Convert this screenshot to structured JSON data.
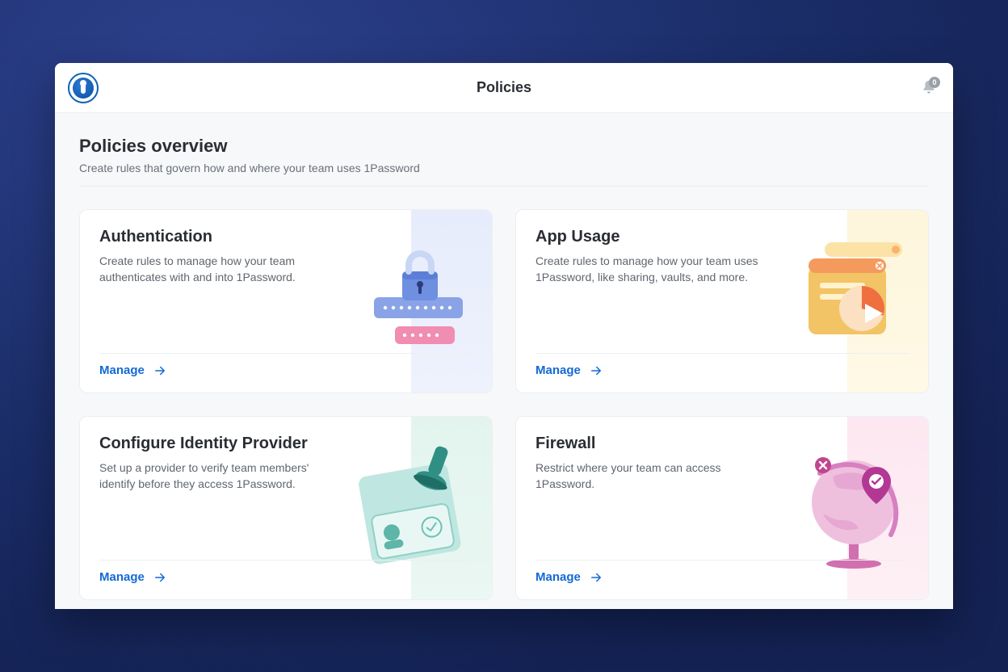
{
  "header": {
    "title": "Policies",
    "notification_count": "0"
  },
  "overview": {
    "title": "Policies overview",
    "subtitle": "Create rules that govern how and where your team uses 1Password"
  },
  "cards": {
    "authentication": {
      "title": "Authentication",
      "description": "Create rules to manage how your team authenticates with and into 1Password.",
      "action_label": "Manage"
    },
    "app_usage": {
      "title": "App Usage",
      "description": "Create rules to manage how your team uses 1Password, like sharing, vaults, and more.",
      "action_label": "Manage"
    },
    "identity_provider": {
      "title": "Configure Identity Provider",
      "description": "Set up a provider to verify team members' identify before they access 1Password.",
      "action_label": "Manage"
    },
    "firewall": {
      "title": "Firewall",
      "description": "Restrict where your team can access 1Password.",
      "action_label": "Manage"
    }
  },
  "colors": {
    "link": "#1469d4"
  }
}
